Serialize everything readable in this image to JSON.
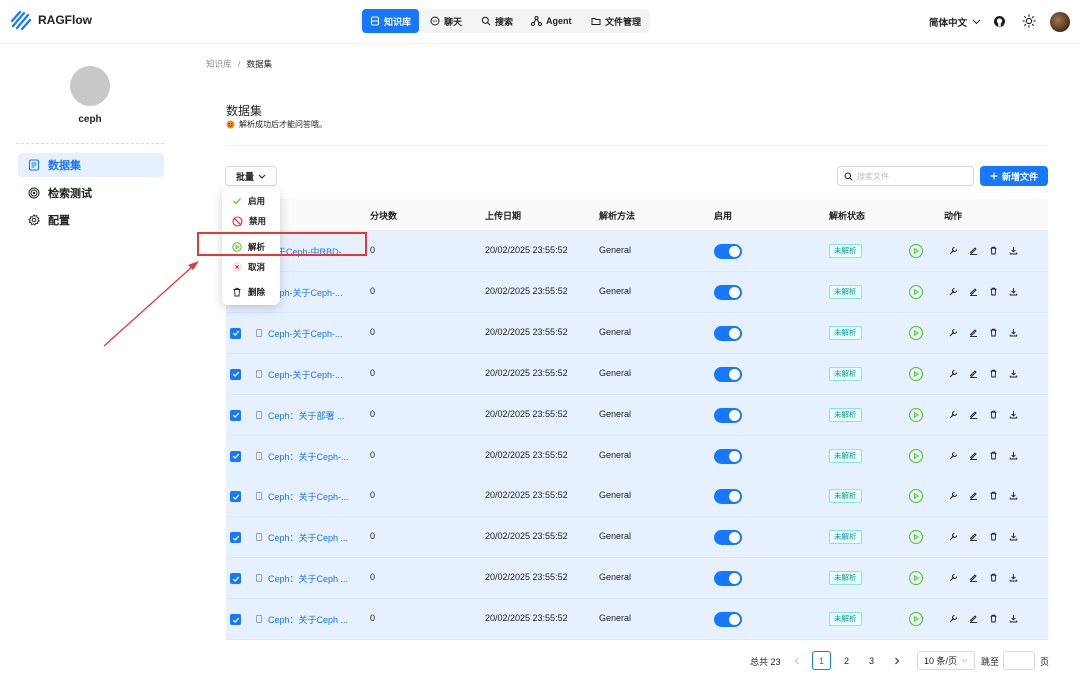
{
  "app": {
    "name": "RAGFlow"
  },
  "nav": {
    "items": [
      {
        "label": "知识库",
        "icon": "database-icon"
      },
      {
        "label": "聊天",
        "icon": "chat-icon"
      },
      {
        "label": "搜索",
        "icon": "search-icon"
      },
      {
        "label": "Agent",
        "icon": "agent-icon"
      },
      {
        "label": "文件管理",
        "icon": "folder-icon"
      }
    ],
    "active": "知识库",
    "language": "简体中文"
  },
  "sidebar": {
    "kb_name": "ceph",
    "items": [
      {
        "label": "数据集",
        "icon": "dataset-icon",
        "active": true
      },
      {
        "label": "检索测试",
        "icon": "retrieval-icon",
        "active": false
      },
      {
        "label": "配置",
        "icon": "gear-icon",
        "active": false
      }
    ]
  },
  "breadcrumb": {
    "root": "知识库",
    "separator": "/",
    "current": "数据集"
  },
  "main": {
    "title": "数据集",
    "hint": "解析成功后才能问答哦。",
    "bulk_label": "批量",
    "search_placeholder": "搜索文件",
    "new_file_label": "新增文件"
  },
  "bulk_menu": [
    {
      "label": "启用",
      "icon": "check-icon"
    },
    {
      "label": "禁用",
      "icon": "forbidden-icon"
    },
    {
      "label": "解析",
      "icon": "play-icon"
    },
    {
      "label": "取消",
      "icon": "close-circle-icon"
    },
    {
      "label": "删除",
      "icon": "trash-icon"
    }
  ],
  "table": {
    "columns": [
      "分块数",
      "上传日期",
      "解析方法",
      "启用",
      "解析状态",
      "动作"
    ],
    "rows": [
      {
        "name": "关于Ceph-中RBD-...",
        "chunks": "0",
        "date": "20/02/2025 23:55:52",
        "method": "General",
        "enabled": true,
        "status": "未解析"
      },
      {
        "name": "Ceph-关于Ceph-...",
        "chunks": "0",
        "date": "20/02/2025 23:55:52",
        "method": "General",
        "enabled": true,
        "status": "未解析"
      },
      {
        "name": "Ceph-关于Ceph-...",
        "chunks": "0",
        "date": "20/02/2025 23:55:52",
        "method": "General",
        "enabled": true,
        "status": "未解析"
      },
      {
        "name": "Ceph-关于Ceph-...",
        "chunks": "0",
        "date": "20/02/2025 23:55:52",
        "method": "General",
        "enabled": true,
        "status": "未解析"
      },
      {
        "name": "Ceph：关于部署 ...",
        "chunks": "0",
        "date": "20/02/2025 23:55:52",
        "method": "General",
        "enabled": true,
        "status": "未解析"
      },
      {
        "name": "Ceph：关于Ceph-...",
        "chunks": "0",
        "date": "20/02/2025 23:55:52",
        "method": "General",
        "enabled": true,
        "status": "未解析"
      },
      {
        "name": "Ceph：关于Ceph-...",
        "chunks": "0",
        "date": "20/02/2025 23:55:52",
        "method": "General",
        "enabled": true,
        "status": "未解析"
      },
      {
        "name": "Ceph：关于Ceph ...",
        "chunks": "0",
        "date": "20/02/2025 23:55:52",
        "method": "General",
        "enabled": true,
        "status": "未解析"
      },
      {
        "name": "Ceph：关于Ceph ...",
        "chunks": "0",
        "date": "20/02/2025 23:55:52",
        "method": "General",
        "enabled": true,
        "status": "未解析"
      },
      {
        "name": "Ceph：关于Ceph ...",
        "chunks": "0",
        "date": "20/02/2025 23:55:52",
        "method": "General",
        "enabled": true,
        "status": "未解析"
      }
    ]
  },
  "pagination": {
    "total_label": "总共 23",
    "pages": [
      "1",
      "2",
      "3"
    ],
    "current": "1",
    "page_size": "10 条/页",
    "jump_label": "跳至",
    "page_word": "页"
  },
  "colors": {
    "accent": "#1677ff",
    "row_selected": "#e6f0ff",
    "highlight": "#e53935",
    "status": "#08979c"
  }
}
